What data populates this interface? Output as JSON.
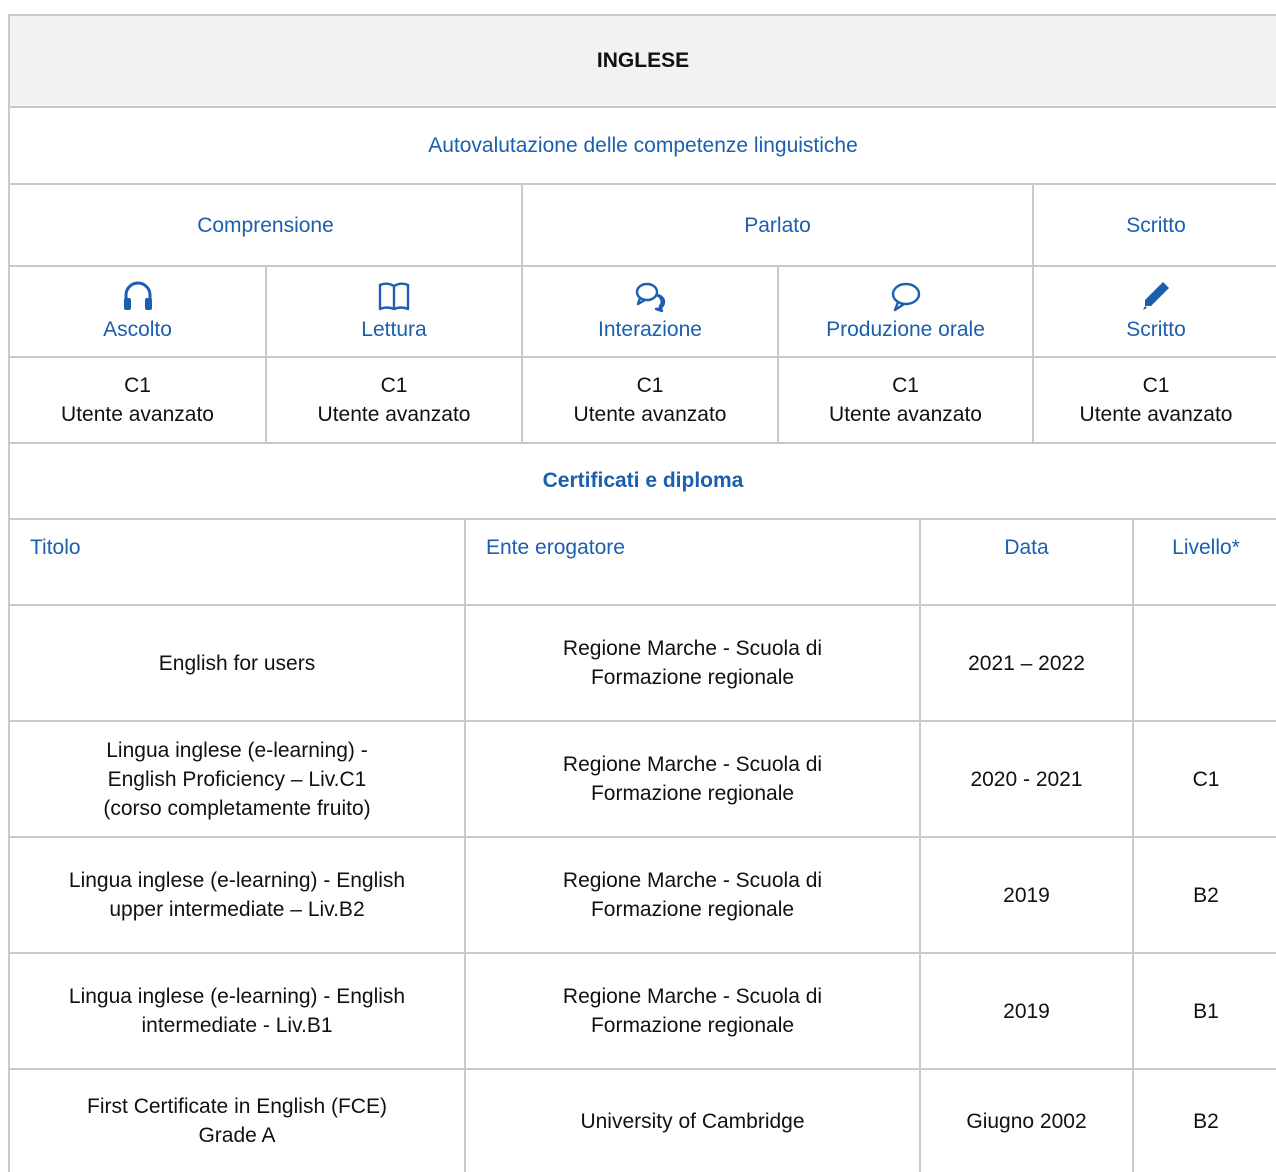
{
  "language": "INGLESE",
  "self_assessment_title": "Autovalutazione delle competenze linguistiche",
  "groups": {
    "comprensione": "Comprensione",
    "parlato": "Parlato",
    "scritto": "Scritto"
  },
  "skills": [
    {
      "label": "Ascolto",
      "icon": "headphones-icon",
      "code": "C1",
      "level": "Utente avanzato"
    },
    {
      "label": "Lettura",
      "icon": "book-icon",
      "code": "C1",
      "level": "Utente avanzato"
    },
    {
      "label": "Interazione",
      "icon": "chat-bubbles-icon",
      "code": "C1",
      "level": "Utente avanzato"
    },
    {
      "label": "Produzione orale",
      "icon": "speech-bubble-icon",
      "code": "C1",
      "level": "Utente avanzato"
    },
    {
      "label": "Scritto",
      "icon": "pencil-icon",
      "code": "C1",
      "level": "Utente avanzato"
    }
  ],
  "certificates_title": "Certificati e diploma",
  "columns": {
    "titolo": "Titolo",
    "ente": "Ente erogatore",
    "data": "Data",
    "livello": "Livello*"
  },
  "certificates": [
    {
      "title_lines": [
        "English for users"
      ],
      "issuer_lines": [
        "Regione Marche - Scuola di",
        "Formazione regionale"
      ],
      "date": "2021 – 2022",
      "level": ""
    },
    {
      "title_lines": [
        "Lingua inglese (e-learning) -",
        "English Proficiency – Liv.C1",
        "(corso completamente fruito)"
      ],
      "issuer_lines": [
        "Regione Marche - Scuola di",
        "Formazione regionale"
      ],
      "date": "2020 - 2021",
      "level": "C1"
    },
    {
      "title_lines": [
        "Lingua inglese (e-learning) - English",
        "upper intermediate – Liv.B2"
      ],
      "issuer_lines": [
        "Regione Marche - Scuola di",
        "Formazione regionale"
      ],
      "date": "2019",
      "level": "B2"
    },
    {
      "title_lines": [
        "Lingua inglese (e-learning) - English",
        "intermediate - Liv.B1"
      ],
      "issuer_lines": [
        "Regione Marche - Scuola di",
        "Formazione regionale"
      ],
      "date": "2019",
      "level": "B1"
    },
    {
      "title_lines": [
        "First Certificate in English (FCE)",
        "Grade A"
      ],
      "issuer_lines": [
        "University of Cambridge"
      ],
      "date": "Giugno 2002",
      "level": "B2"
    }
  ],
  "colors": {
    "accent": "#1b5fae",
    "header_bg": "#f2f2f2",
    "border": "#c9c9c9"
  }
}
